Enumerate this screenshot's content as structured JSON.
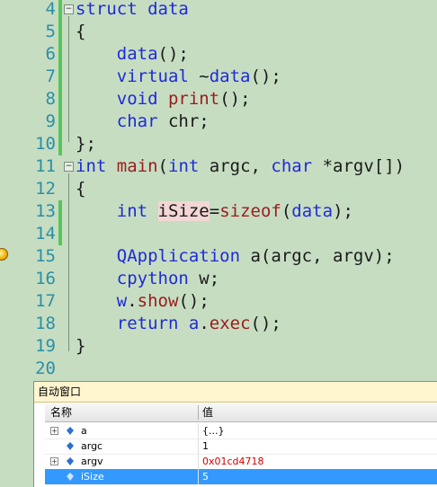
{
  "editor": {
    "lines": [
      {
        "num": "4",
        "text": "struct data"
      },
      {
        "num": "5",
        "text": "{"
      },
      {
        "num": "6",
        "text": "    data();"
      },
      {
        "num": "7",
        "text": "    virtual ~data();"
      },
      {
        "num": "8",
        "text": "    void print();"
      },
      {
        "num": "9",
        "text": "    char chr;"
      },
      {
        "num": "10",
        "text": "};"
      },
      {
        "num": "11",
        "text": "int main(int argc, char *argv[])"
      },
      {
        "num": "12",
        "text": "{"
      },
      {
        "num": "13",
        "text": "    int iSize=sizeof(data);"
      },
      {
        "num": "14",
        "text": ""
      },
      {
        "num": "15",
        "text": "    QApplication a(argc, argv);"
      },
      {
        "num": "16",
        "text": "    cpython w;"
      },
      {
        "num": "17",
        "text": "    w.show();"
      },
      {
        "num": "18",
        "text": "    return a.exec();"
      },
      {
        "num": "19",
        "text": "}"
      },
      {
        "num": "20",
        "text": ""
      }
    ]
  },
  "autos": {
    "title": "自动窗口",
    "col_name": "名称",
    "col_value": "值",
    "rows": [
      {
        "name": "a",
        "value": "{...}"
      },
      {
        "name": "argc",
        "value": "1"
      },
      {
        "name": "argv",
        "value": "0x01cd4718"
      },
      {
        "name": "iSize",
        "value": "5"
      }
    ]
  }
}
